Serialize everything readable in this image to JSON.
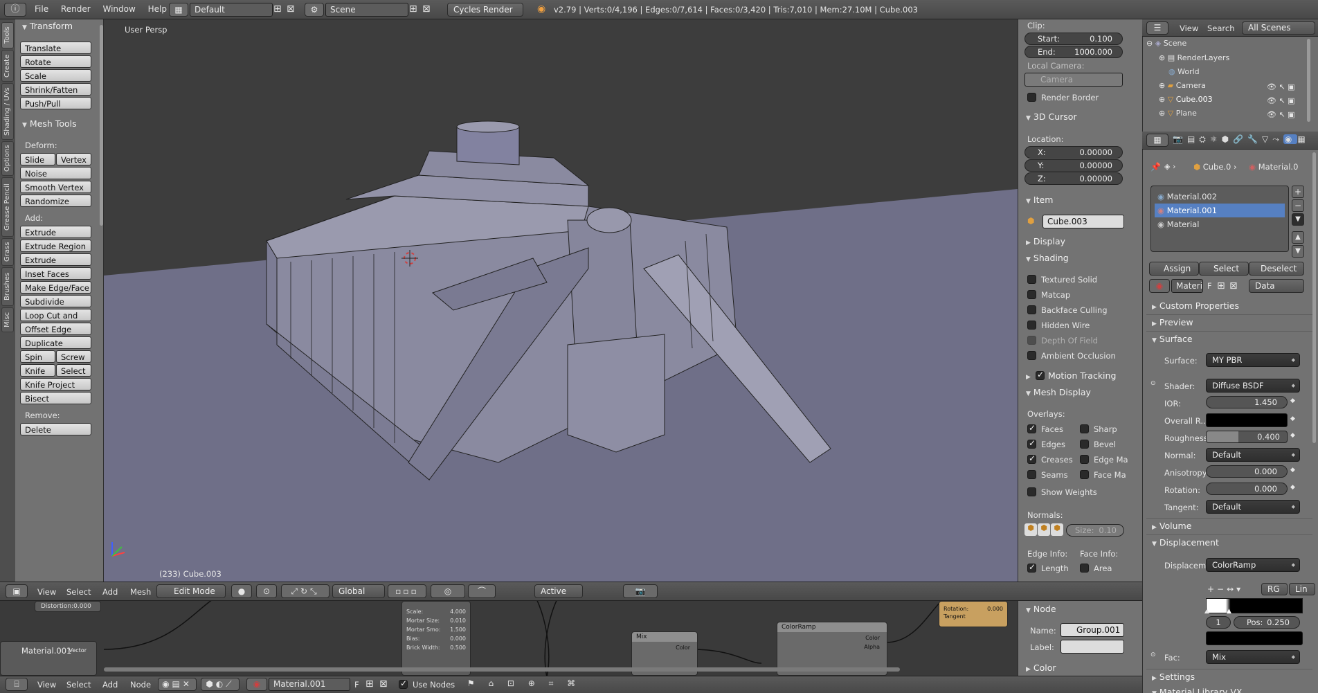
{
  "topbar": {
    "menus": [
      "File",
      "Render",
      "Window",
      "Help"
    ],
    "layout": "Default",
    "scene": "Scene",
    "engine": "Cycles Render",
    "stats": "v2.79 | Verts:0/4,196 | Edges:0/7,614 | Faces:0/3,420 | Tris:7,010 | Mem:27.10M | Cube.003"
  },
  "toolshelf": {
    "tabs": [
      "Tools",
      "Create",
      "Shading / UVs",
      "Options",
      "Grease Pencil",
      "Grass",
      "Brushes",
      "Misc"
    ],
    "transform_header": "Transform",
    "transform_buttons": [
      "Translate",
      "Rotate",
      "Scale",
      "Shrink/Fatten",
      "Push/Pull"
    ],
    "meshtools_header": "Mesh Tools",
    "deform_label": "Deform:",
    "slide_edge": "Slide Ed",
    "vertex": "Vertex",
    "deform_buttons": [
      "Noise",
      "Smooth Vertex",
      "Randomize"
    ],
    "add_label": "Add:",
    "extrude": "Extrude",
    "add_buttons": [
      "Extrude Region",
      "Extrude Individual",
      "Inset Faces",
      "Make Edge/Face",
      "Subdivide",
      "Loop Cut and Slide",
      "Offset Edge Slide",
      "Duplicate"
    ],
    "spin": "Spin",
    "screw": "Screw",
    "knife": "Knife",
    "select": "Select",
    "more_buttons": [
      "Knife Project",
      "Bisect"
    ],
    "remove_label": "Remove:",
    "delete": "Delete"
  },
  "viewport": {
    "view_label": "User Persp",
    "object_info": "(233) Cube.003"
  },
  "viewport_header": {
    "menus": [
      "View",
      "Select",
      "Add",
      "Mesh"
    ],
    "mode": "Edit Mode",
    "orientation": "Global",
    "pivot": "Active"
  },
  "npanel": {
    "clip_label": "Clip:",
    "start_k": "Start:",
    "start_v": "0.100",
    "end_k": "End:",
    "end_v": "1000.000",
    "local_camera": "Local Camera:",
    "camera": "Camera",
    "render_border": "Render Border",
    "cursor_header": "3D Cursor",
    "location": "Location:",
    "x_k": "X:",
    "x_v": "0.00000",
    "y_k": "Y:",
    "y_v": "0.00000",
    "z_k": "Z:",
    "z_v": "0.00000",
    "item_header": "Item",
    "item_name": "Cube.003",
    "display_header": "Display",
    "shading_header": "Shading",
    "shading_options": [
      "Textured Solid",
      "Matcap",
      "Backface Culling",
      "Hidden Wire",
      "Depth Of Field",
      "Ambient Occlusion"
    ],
    "motion_tracking": "Motion Tracking",
    "mesh_display_header": "Mesh Display",
    "overlays": "Overlays:",
    "ov_left": [
      "Faces",
      "Edges",
      "Creases",
      "Seams"
    ],
    "ov_right": [
      "Sharp",
      "Bevel",
      "Edge Ma",
      "Face Ma"
    ],
    "show_weights": "Show Weights",
    "normals": "Normals:",
    "size": "Size:",
    "size_v": "0.10",
    "edge_info": "Edge Info:",
    "face_info": "Face Info:",
    "length": "Length",
    "area": "Area",
    "node_header": "Node",
    "name_k": "Name:",
    "name_v": "Group.001",
    "label_k": "Label:",
    "color_header": "Color"
  },
  "outliner": {
    "menus": [
      "View",
      "Search"
    ],
    "filter": "All Scenes",
    "items": [
      "Scene",
      "RenderLayers",
      "World",
      "Camera",
      "Cube.003",
      "Plane"
    ]
  },
  "properties": {
    "breadcrumb_obj": "Cube.0",
    "breadcrumb_mat": "Material.0",
    "materials": [
      "Material.002",
      "Material.001",
      "Material"
    ],
    "assign": "Assign",
    "select": "Select",
    "deselect": "Deselect",
    "mat_field": "Materi",
    "f": "F",
    "data": "Data",
    "sections": [
      "Custom Properties",
      "Preview"
    ],
    "surface_header": "Surface",
    "surface_k": "Surface:",
    "surface_v": "MY PBR",
    "shader_k": "Shader:",
    "shader_v": "Diffuse BSDF",
    "ior_k": "IOR:",
    "ior_v": "1.450",
    "overall_k": "Overall R...",
    "roughness_k": "Roughness:",
    "roughness_v": "0.400",
    "normal_k": "Normal:",
    "normal_v": "Default",
    "aniso_k": "Anisotropy:",
    "aniso_v": "0.000",
    "rotation_k": "Rotation:",
    "rotation_v": "0.000",
    "tangent_k": "Tangent:",
    "tangent_v": "Default",
    "volume": "Volume",
    "displacement_header": "Displacement",
    "displ_k": "Displacem...",
    "displ_v": "ColorRamp",
    "rgb": "RG",
    "lin": "Lin",
    "ramp_index": "1",
    "pos_k": "Pos:",
    "pos_v": "0.250",
    "fac_k": "Fac:",
    "fac_v": "Mix",
    "settings": "Settings",
    "matlib": "Material Library VX"
  },
  "node_editor": {
    "header_menus": [
      "View",
      "Select",
      "Add",
      "Node"
    ],
    "material": "Material.001",
    "f": "F",
    "use_nodes": "Use Nodes",
    "distortion": "Distortion:0.000",
    "mat_node": "Material.001",
    "vector": "Vector",
    "brick_fields": [
      "Scale:",
      "Mortar Size:",
      "Mortar Smo:",
      "Bias:",
      "Brick Width:"
    ],
    "brick_vals": [
      "4.000",
      "0.010",
      "1.500",
      "0.000",
      "0.500"
    ],
    "mix": "Mix",
    "color": "Color",
    "colorramp": "ColorRamp",
    "alpha": "Alpha",
    "rotation": "Rotation:",
    "rotation_v": "0.000",
    "tangent": "Tangent"
  }
}
